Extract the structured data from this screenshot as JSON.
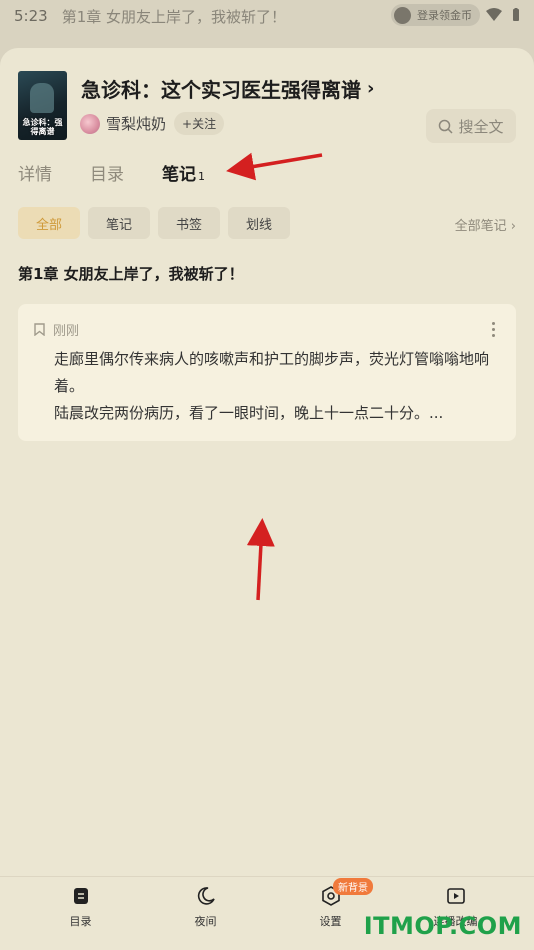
{
  "status_bar": {
    "time": "5:23",
    "background_title": "第1章 女朋友上岸了，我被斩了！",
    "coin_label": "登录领金币"
  },
  "book": {
    "cover_text": "急诊科：强得离谱",
    "title": "急诊科：这个实习医生强得离谱",
    "author": "雪梨炖奶",
    "follow_label": "+关注",
    "search_label": "搜全文"
  },
  "tabs": [
    {
      "label": "详情"
    },
    {
      "label": "目录"
    },
    {
      "label": "笔记",
      "count": "1"
    }
  ],
  "filters": [
    {
      "label": "全部",
      "active": true
    },
    {
      "label": "笔记"
    },
    {
      "label": "书签"
    },
    {
      "label": "划线"
    }
  ],
  "all_notes_label": "全部笔记",
  "chapter_title": "第1章 女朋友上岸了，我被斩了！",
  "note": {
    "time": "刚刚",
    "text_line1": "走廊里偶尔传来病人的咳嗽声和护工的脚步声，荧光灯管嗡嗡地响着。",
    "text_line2": "陆晨改完两份病历，看了一眼时间，晚上十一点二十分。..."
  },
  "bottom_nav": [
    {
      "label": "目录",
      "icon": "catalog-icon"
    },
    {
      "label": "夜间",
      "icon": "moon-icon"
    },
    {
      "label": "设置",
      "icon": "settings-icon",
      "badge": "新背景"
    },
    {
      "label": "连播改编",
      "icon": "video-icon"
    }
  ],
  "watermark": "ITMOP.COM",
  "colors": {
    "sheet_bg": "#ebe6d2",
    "accent": "#cf9a3a",
    "arrow": "#d42020",
    "badge": "#f07a3c"
  }
}
